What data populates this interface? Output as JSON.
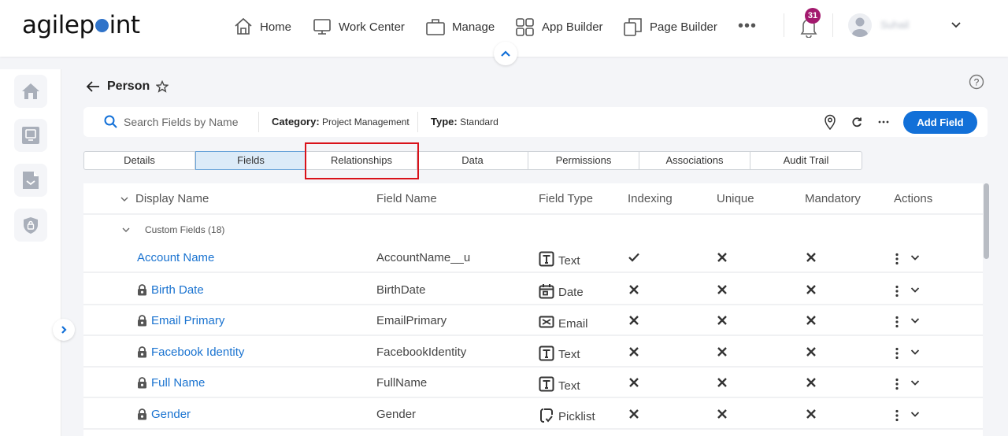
{
  "header": {
    "logo": {
      "pre": "agilep",
      "post": "int"
    },
    "nav": [
      {
        "label": "Home",
        "icon": "home-icon"
      },
      {
        "label": "Work Center",
        "icon": "monitor-icon"
      },
      {
        "label": "Manage",
        "icon": "briefcase-icon"
      },
      {
        "label": "App Builder",
        "icon": "grid-icon"
      },
      {
        "label": "Page Builder",
        "icon": "pages-icon"
      }
    ],
    "more_label": "•••",
    "notifications_count": "31",
    "user_name": "Suhail"
  },
  "sidebar": {
    "items": [
      {
        "name": "home",
        "icon": "home-icon"
      },
      {
        "name": "work-center",
        "icon": "monitor-icon"
      },
      {
        "name": "documents",
        "icon": "document-icon"
      },
      {
        "name": "security",
        "icon": "shield-lock-icon"
      }
    ]
  },
  "page": {
    "title": "Person",
    "search_placeholder": "Search Fields by Name",
    "category_label": "Category:",
    "category_value": "Project Management",
    "type_label": "Type:",
    "type_value": "Standard",
    "add_field_label": "Add Field"
  },
  "tabs": [
    {
      "label": "Details",
      "active": false
    },
    {
      "label": "Fields",
      "active": true
    },
    {
      "label": "Relationships",
      "active": false,
      "highlighted": true
    },
    {
      "label": "Data",
      "active": false
    },
    {
      "label": "Permissions",
      "active": false
    },
    {
      "label": "Associations",
      "active": false
    },
    {
      "label": "Audit Trail",
      "active": false
    }
  ],
  "table": {
    "columns": [
      "Display Name",
      "Field Name",
      "Field Type",
      "Indexing",
      "Unique",
      "Mandatory",
      "Actions"
    ],
    "group": {
      "label": "Custom Fields (18)"
    },
    "rows": [
      {
        "display": "Account Name",
        "field": "AccountName__u",
        "type": "Text",
        "type_icon": "text-type-icon",
        "locked": false,
        "indexing": true,
        "unique": false,
        "mandatory": false
      },
      {
        "display": "Birth Date",
        "field": "BirthDate",
        "type": "Date",
        "type_icon": "calendar-icon",
        "locked": true,
        "indexing": false,
        "unique": false,
        "mandatory": false
      },
      {
        "display": "Email Primary",
        "field": "EmailPrimary",
        "type": "Email",
        "type_icon": "email-icon",
        "locked": true,
        "indexing": false,
        "unique": false,
        "mandatory": false
      },
      {
        "display": "Facebook Identity",
        "field": "FacebookIdentity",
        "type": "Text",
        "type_icon": "text-type-icon",
        "locked": true,
        "indexing": false,
        "unique": false,
        "mandatory": false
      },
      {
        "display": "Full Name",
        "field": "FullName",
        "type": "Text",
        "type_icon": "text-type-icon",
        "locked": true,
        "indexing": false,
        "unique": false,
        "mandatory": false
      },
      {
        "display": "Gender",
        "field": "Gender",
        "type": "Picklist",
        "type_icon": "picklist-icon",
        "locked": true,
        "indexing": false,
        "unique": false,
        "mandatory": false
      }
    ]
  },
  "colors": {
    "accent": "#1270d8",
    "link": "#1a73d0",
    "badge": "#a3196e",
    "highlight": "#d9121a",
    "active_tab": "#dcebf8"
  }
}
